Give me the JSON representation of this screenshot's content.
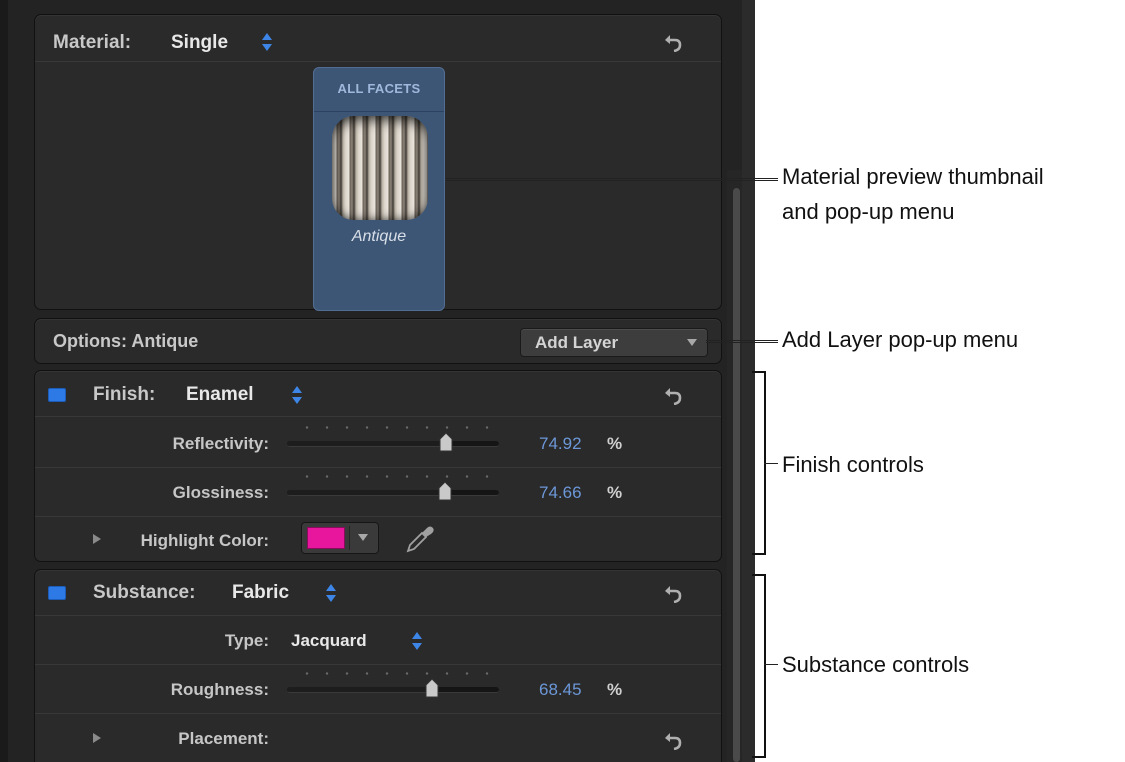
{
  "material": {
    "title": "Material:",
    "value": "Single",
    "tile_header": "ALL FACETS",
    "preset_name": "Antique"
  },
  "options": {
    "title": "Options: Antique",
    "add_layer_label": "Add Layer"
  },
  "finish": {
    "title": "Finish:",
    "value": "Enamel",
    "enabled": true,
    "reflectivity": {
      "label": "Reflectivity:",
      "value": "74.92",
      "unit": "%",
      "level": 0.7492
    },
    "glossiness": {
      "label": "Glossiness:",
      "value": "74.66",
      "unit": "%",
      "level": 0.7466
    },
    "highlight_color": {
      "label": "Highlight Color:",
      "color": "#e8169c"
    }
  },
  "substance": {
    "title": "Substance:",
    "value": "Fabric",
    "enabled": true,
    "type": {
      "label": "Type:",
      "value": "Jacquard"
    },
    "roughness": {
      "label": "Roughness:",
      "value": "68.45",
      "unit": "%",
      "level": 0.6845
    },
    "placement": {
      "label": "Placement:"
    }
  },
  "callouts": {
    "preview": [
      "Material preview thumbnail",
      "and pop-up menu"
    ],
    "add_layer": "Add Layer pop-up menu",
    "finish": "Finish controls",
    "substance": "Substance controls"
  },
  "colors": {
    "accent": "#6c97d8",
    "checkbox": "#2d7ae6",
    "highlight": "#e8169c",
    "tile": "#3e5676"
  },
  "icons": [
    "updown-arrows-icon",
    "reset-arrow-icon",
    "disclosure-triangle-icon",
    "eyedropper-icon",
    "popup-arrow-icon"
  ]
}
